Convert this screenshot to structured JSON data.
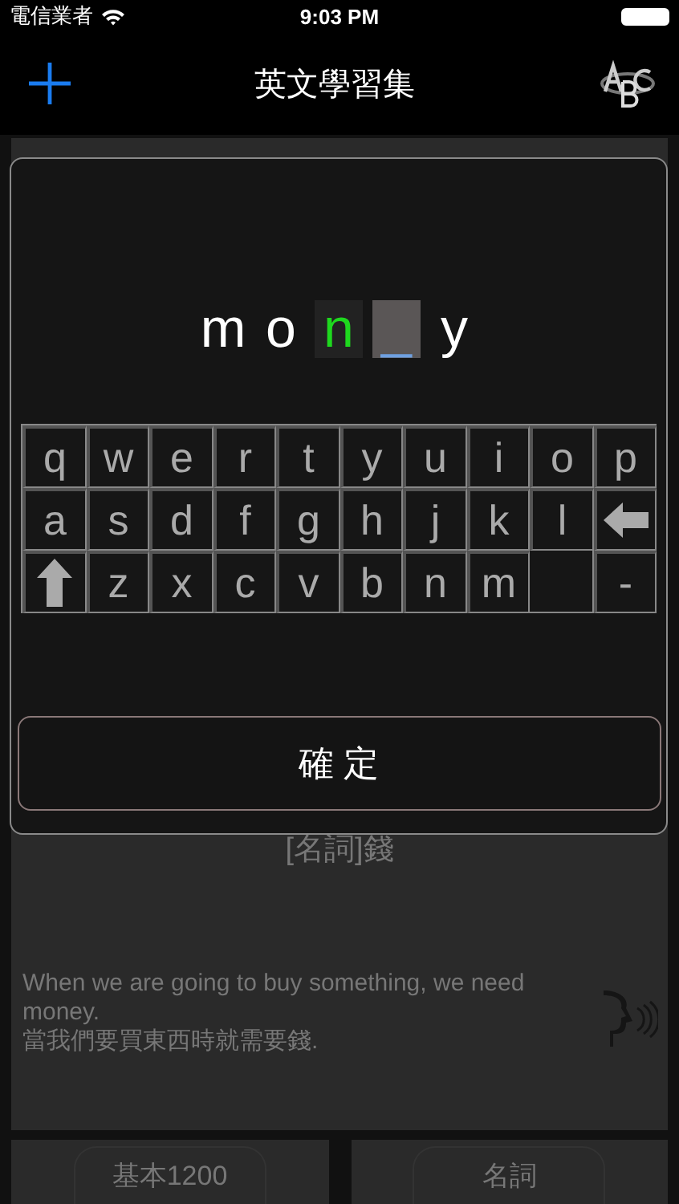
{
  "status_bar": {
    "carrier": "電信業者",
    "time": "9:03 PM"
  },
  "nav_bar": {
    "title": "英文學習集"
  },
  "card": {
    "meaning": "[名詞]錢",
    "example_en": "When we are going to buy something, we need money.",
    "example_zh": "當我們要買東西時就需要錢."
  },
  "bottom_bar": [
    {
      "label": "基本1200"
    },
    {
      "label": "名詞"
    }
  ],
  "dialog": {
    "letters": [
      {
        "char": "m",
        "kind": "given"
      },
      {
        "char": "o",
        "kind": "given"
      },
      {
        "char": "n",
        "kind": "filled"
      },
      {
        "char": "_",
        "kind": "cursor"
      },
      {
        "char": "y",
        "kind": "given"
      }
    ],
    "keyboard": [
      [
        {
          "kind": "letter",
          "char": "q"
        },
        {
          "kind": "letter",
          "char": "w"
        },
        {
          "kind": "letter",
          "char": "e"
        },
        {
          "kind": "letter",
          "char": "r"
        },
        {
          "kind": "letter",
          "char": "t"
        },
        {
          "kind": "letter",
          "char": "y"
        },
        {
          "kind": "letter",
          "char": "u"
        },
        {
          "kind": "letter",
          "char": "i"
        },
        {
          "kind": "letter",
          "char": "o"
        },
        {
          "kind": "letter",
          "char": "p"
        }
      ],
      [
        {
          "kind": "letter",
          "char": "a"
        },
        {
          "kind": "letter",
          "char": "s"
        },
        {
          "kind": "letter",
          "char": "d"
        },
        {
          "kind": "letter",
          "char": "f"
        },
        {
          "kind": "letter",
          "char": "g"
        },
        {
          "kind": "letter",
          "char": "h"
        },
        {
          "kind": "letter",
          "char": "j"
        },
        {
          "kind": "letter",
          "char": "k"
        },
        {
          "kind": "letter",
          "char": "l"
        },
        {
          "kind": "backspace"
        }
      ],
      [
        {
          "kind": "shift"
        },
        {
          "kind": "letter",
          "char": "z"
        },
        {
          "kind": "letter",
          "char": "x"
        },
        {
          "kind": "letter",
          "char": "c"
        },
        {
          "kind": "letter",
          "char": "v"
        },
        {
          "kind": "letter",
          "char": "b"
        },
        {
          "kind": "letter",
          "char": "n"
        },
        {
          "kind": "letter",
          "char": "m"
        },
        {
          "kind": "empty"
        },
        {
          "kind": "letter",
          "char": "-"
        }
      ]
    ],
    "confirm_button": "確 定"
  }
}
